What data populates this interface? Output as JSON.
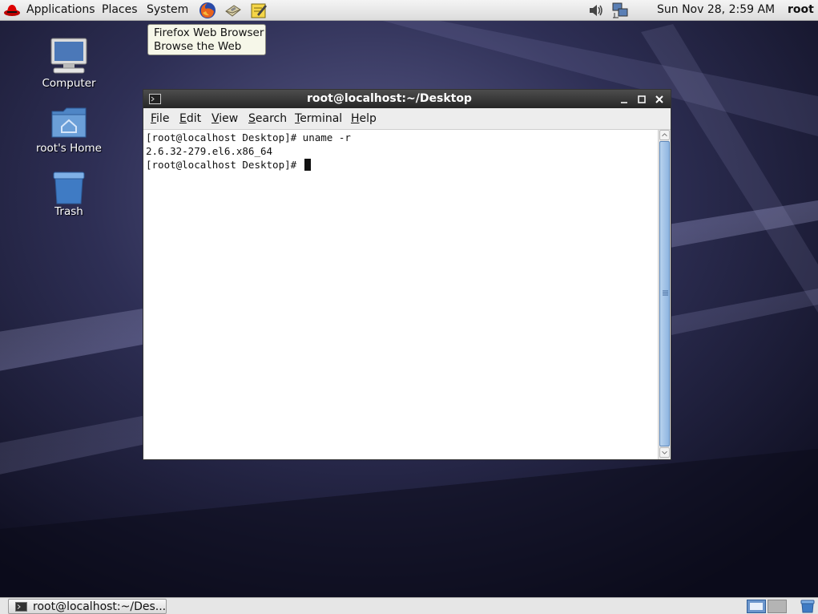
{
  "top_panel": {
    "applications_label": "Applications",
    "places_label": "Places",
    "system_label": "System",
    "clock": "Sun Nov 28,  2:59 AM",
    "user": "root",
    "launchers": [
      "firefox-icon",
      "mail-icon",
      "notes-icon"
    ],
    "tray_icons": [
      "volume-icon",
      "network-icon"
    ]
  },
  "tooltip": {
    "title": "Firefox Web Browser",
    "description": "Browse the Web"
  },
  "desktop": {
    "icons": [
      {
        "label": "Computer",
        "icon": "computer-icon"
      },
      {
        "label": "root's Home",
        "icon": "home-folder-icon"
      },
      {
        "label": "Trash",
        "icon": "trash-icon"
      }
    ]
  },
  "window": {
    "title": "root@localhost:~/Desktop",
    "menu": [
      "File",
      "Edit",
      "View",
      "Search",
      "Terminal",
      "Help"
    ],
    "menu_mnemonics": [
      "F",
      "E",
      "V",
      "S",
      "T",
      "H"
    ],
    "terminal_lines": [
      "[root@localhost Desktop]# uname -r",
      "2.6.32-279.el6.x86_64",
      "[root@localhost Desktop]# "
    ]
  },
  "taskbar": {
    "task_label": "root@localhost:~/Des..."
  },
  "colors": {
    "panel": "#e6e6e6",
    "titlebar": "#333333",
    "scroll_thumb": "#a6c4e8",
    "wallpaper": "#141428"
  }
}
